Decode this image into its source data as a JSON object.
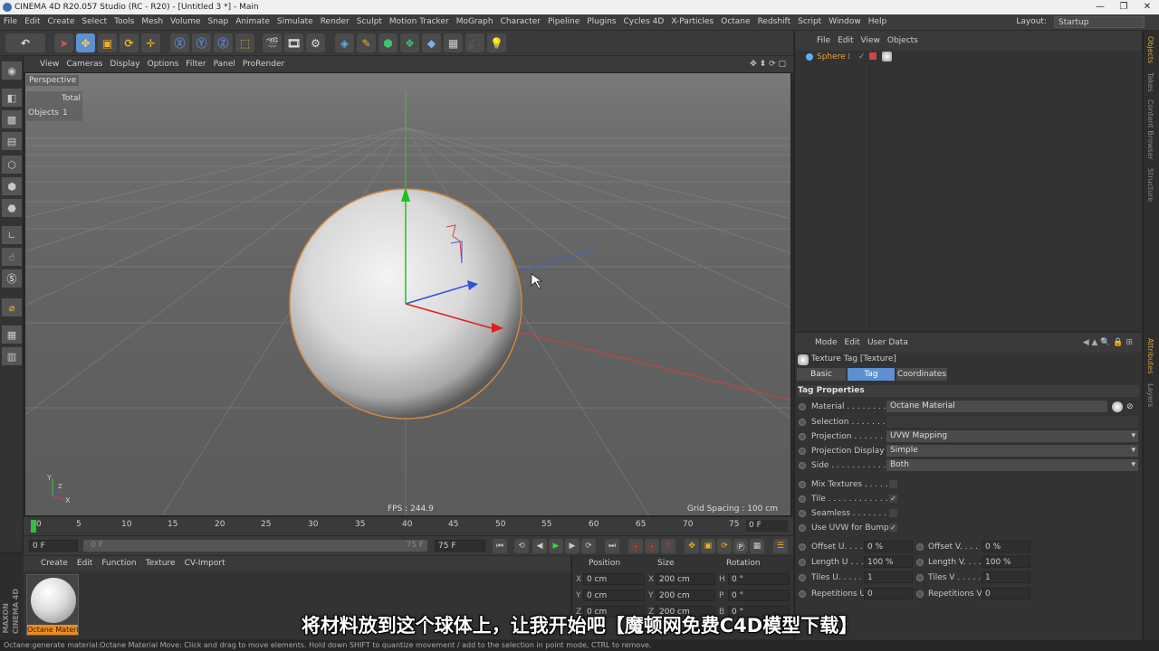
{
  "window": {
    "title": "CINEMA 4D R20.057 Studio (RC - R20) - [Untitled 3 *] - Main",
    "min": "—",
    "max": "❐",
    "close": "✕"
  },
  "menubar": {
    "items": [
      "File",
      "Edit",
      "Create",
      "Select",
      "Tools",
      "Mesh",
      "Volume",
      "Snap",
      "Animate",
      "Simulate",
      "Render",
      "Sculpt",
      "Motion Tracker",
      "MoGraph",
      "Character",
      "Pipeline",
      "Plugins",
      "Cycles 4D",
      "X-Particles",
      "Octane",
      "Redshift",
      "Script",
      "Window",
      "Help"
    ],
    "layout_label": "Layout:",
    "layout_value": "Startup"
  },
  "viewport": {
    "menu": [
      "View",
      "Cameras",
      "Display",
      "Options",
      "Filter",
      "Panel",
      "ProRender"
    ],
    "label": "Perspective",
    "stats_total": "Total",
    "stats_objects_label": "Objects",
    "stats_objects_value": "1",
    "fps": "FPS : 244.9",
    "grid_spacing": "Grid Spacing : 100 cm",
    "axis_x": "X",
    "axis_y": "Y",
    "axis_z": "Z"
  },
  "timeline": {
    "ticks": [
      "0",
      "5",
      "10",
      "15",
      "20",
      "25",
      "30",
      "35",
      "40",
      "45",
      "50",
      "55",
      "60",
      "65",
      "70",
      "75"
    ],
    "current_frame": "0 F"
  },
  "transport": {
    "start": "0 F",
    "slider_start": "0 F",
    "slider_end": "75 F",
    "end": "75 F"
  },
  "material_manager": {
    "menu": [
      "Create",
      "Edit",
      "Function",
      "Texture",
      "CV-Import"
    ],
    "material_name": "Octane Material"
  },
  "branding": {
    "maxon": "MAXON",
    "product": "CINEMA 4D"
  },
  "coordinates": {
    "headers": [
      "Position",
      "Size",
      "Rotation"
    ],
    "rows": [
      {
        "axis": "X",
        "pos": "0 cm",
        "size_axis": "X",
        "size": "200 cm",
        "rot_axis": "H",
        "rot": "0 °"
      },
      {
        "axis": "Y",
        "pos": "0 cm",
        "size_axis": "Y",
        "size": "200 cm",
        "rot_axis": "P",
        "rot": "0 °"
      },
      {
        "axis": "Z",
        "pos": "0 cm",
        "size_axis": "Z",
        "size": "200 cm",
        "rot_axis": "B",
        "rot": "0 °"
      }
    ]
  },
  "object_manager": {
    "menu": [
      "File",
      "Edit",
      "View",
      "Objects"
    ],
    "object_name": "Sphere"
  },
  "attributes": {
    "menu": [
      "Mode",
      "Edit",
      "User Data"
    ],
    "title": "Texture Tag [Texture]",
    "tabs": [
      "Basic",
      "Tag",
      "Coordinates"
    ],
    "section": "Tag Properties",
    "material_label": "Material . . . . . . . . .",
    "material_value": "Octane Material",
    "selection_label": "Selection . . . . . . . . .",
    "selection_value": "",
    "projection_label": "Projection . . . . . . . .",
    "projection_value": "UVW Mapping",
    "projection_display_label": "Projection Display .",
    "projection_display_value": "Simple",
    "side_label": "Side . . . . . . . . . . . .",
    "side_value": "Both",
    "mix_textures_label": "Mix Textures . . . . . .",
    "tile_label": "Tile . . . . . . . . . . . .",
    "seamless_label": "Seamless . . . . . . . . .",
    "uvw_bump_label": "Use UVW for Bump",
    "check": "✓",
    "offset_u_label": "Offset U. . . . .",
    "offset_u": "0 %",
    "offset_v_label": "Offset V. . . . .",
    "offset_v": "0 %",
    "length_u_label": "Length U . . . .",
    "length_u": "100 %",
    "length_v_label": "Length V. . . . .",
    "length_v": "100 %",
    "tiles_u_label": "Tiles U. . . . . .",
    "tiles_u": "1",
    "tiles_v_label": "Tiles V . . . . . .",
    "tiles_v": "1",
    "rep_u_label": "Repetitions U",
    "rep_u": "0",
    "rep_v_label": "Repetitions V",
    "rep_v": "0"
  },
  "right_tabs": [
    "Objects",
    "Takes",
    "Content Browser",
    "Structure",
    "Attributes",
    "Layers"
  ],
  "status": "Octane:generate material:Octane Material    Move: Click and drag to move elements. Hold down SHIFT to quantize movement / add to the selection in point mode, CTRL to remove.",
  "subtitle": "将材料放到这个球体上，让我开始吧【魔顿网免费C4D模型下载】",
  "colors": {
    "accent": "#5d8fd1",
    "orange": "#f08c1a",
    "axis_x": "#e03030",
    "axis_y": "#30c030",
    "axis_z": "#3050e0"
  }
}
